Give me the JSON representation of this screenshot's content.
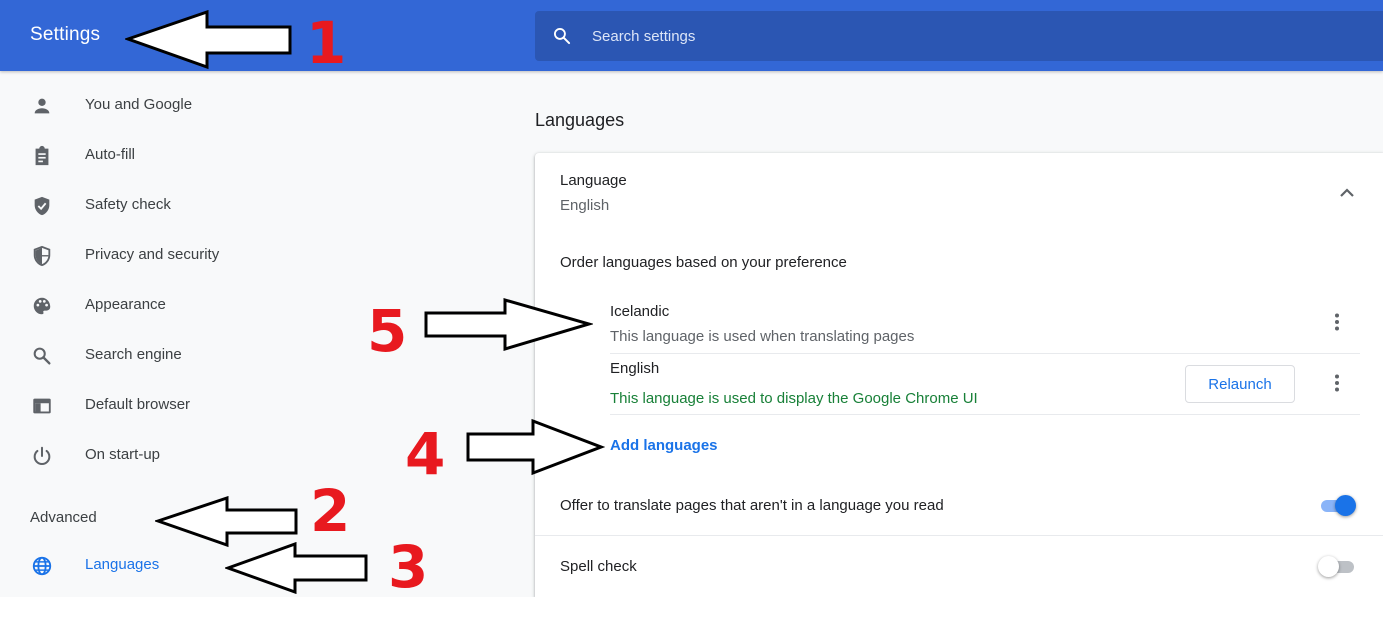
{
  "header": {
    "title": "Settings",
    "search_placeholder": "Search settings"
  },
  "sidebar": {
    "items": [
      {
        "label": "You and Google",
        "icon": "person-icon"
      },
      {
        "label": "Auto-fill",
        "icon": "clipboard-icon"
      },
      {
        "label": "Safety check",
        "icon": "shield-check-icon"
      },
      {
        "label": "Privacy and security",
        "icon": "shield-half-icon"
      },
      {
        "label": "Appearance",
        "icon": "palette-icon"
      },
      {
        "label": "Search engine",
        "icon": "search-icon"
      },
      {
        "label": "Default browser",
        "icon": "browser-icon"
      },
      {
        "label": "On start-up",
        "icon": "power-icon"
      }
    ],
    "advanced_label": "Advanced",
    "active_item": {
      "label": "Languages",
      "icon": "globe-icon"
    }
  },
  "main": {
    "section_title": "Languages",
    "language_heading": "Language",
    "language_current": "English",
    "order_text": "Order languages based on your preference",
    "languages": [
      {
        "name": "Icelandic",
        "description": "This language is used when translating pages"
      },
      {
        "name": "English",
        "description": "This language is used to display the Google Chrome UI"
      }
    ],
    "relaunch_label": "Relaunch",
    "add_languages_label": "Add languages",
    "translate_text": "Offer to translate pages that aren't in a language you read",
    "translate_enabled": true,
    "spell_check_text": "Spell check",
    "spell_check_enabled": false
  },
  "annotations": {
    "numbers": [
      "1",
      "2",
      "3",
      "4",
      "5"
    ]
  },
  "colors": {
    "header_bg": "#3367d6",
    "search_bg": "#2b56b3",
    "accent": "#1a73e8",
    "success_text": "#188038",
    "annotation_red": "#e8191f"
  }
}
